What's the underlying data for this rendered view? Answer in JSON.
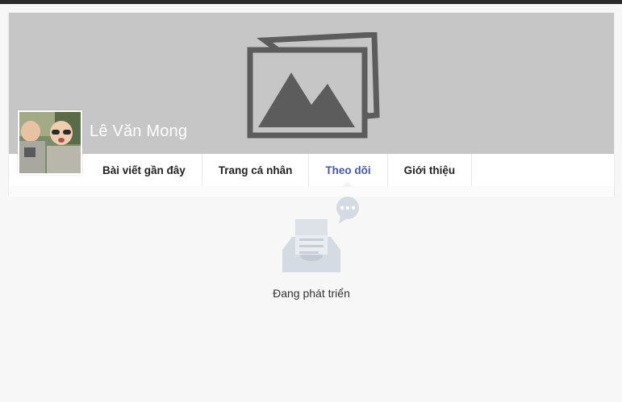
{
  "profile": {
    "name": "Lê Văn Mong"
  },
  "tabs": [
    {
      "label": "Bài viết gần đây",
      "active": false
    },
    {
      "label": "Trang cá nhân",
      "active": false
    },
    {
      "label": "Theo dõi",
      "active": true
    },
    {
      "label": "Giới thiệu",
      "active": false
    }
  ],
  "empty_state": {
    "message": "Đang phát triển",
    "icon": "inbox-tray-icon"
  },
  "colors": {
    "accent": "#4457a8",
    "cover_bg": "#c6c6c6",
    "icon_gray": "#5c5c5c"
  }
}
